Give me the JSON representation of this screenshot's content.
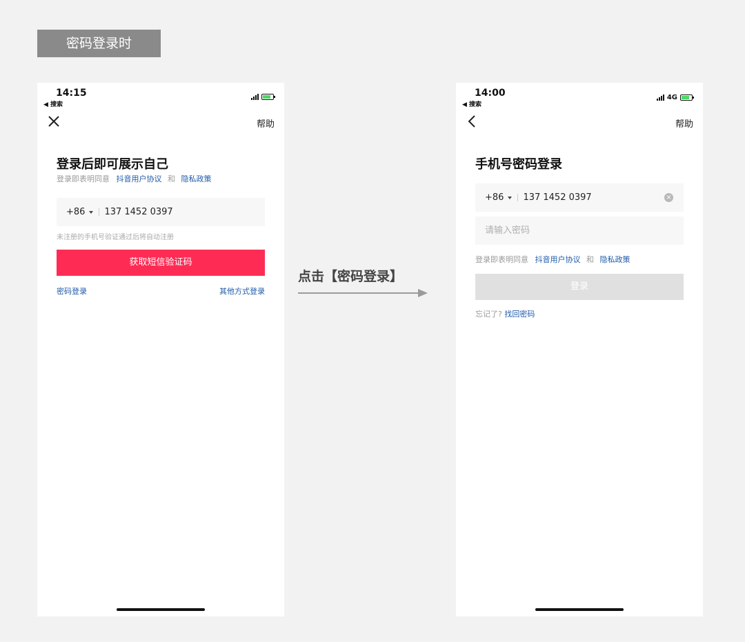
{
  "section_title": "密码登录时",
  "step_label": "点击【密码登录】",
  "left_screen": {
    "status": {
      "time": "14:15",
      "back": "◀ 搜索"
    },
    "help_label": "帮助",
    "title": "登录后即可展示自己",
    "agree_prefix": "登录即表明同意",
    "agree_link1": "抖音用户协议",
    "agree_and": "和",
    "agree_link2": "隐私政策",
    "country_code": "+86",
    "phone_number": "137 1452 0397",
    "hint": "未注册的手机号验证通过后将自动注册",
    "primary_button": "获取短信验证码",
    "password_login_link": "密码登录",
    "other_login_link": "其他方式登录"
  },
  "right_screen": {
    "status": {
      "time": "14:00",
      "back": "◀ 搜索",
      "network": "4G"
    },
    "help_label": "帮助",
    "title": "手机号密码登录",
    "country_code": "+86",
    "phone_number": "137 1452 0397",
    "password_placeholder": "请输入密码",
    "agree_prefix": "登录即表明同意",
    "agree_link1": "抖音用户协议",
    "agree_and": "和",
    "agree_link2": "隐私政策",
    "login_button": "登录",
    "forgot_prefix": "忘记了?",
    "forgot_link": "找回密码"
  },
  "colors": {
    "accent": "#fe2c55",
    "link": "#1f5aa8",
    "disabled": "#e0e0e0",
    "tag_bg": "#8a8a8a"
  }
}
